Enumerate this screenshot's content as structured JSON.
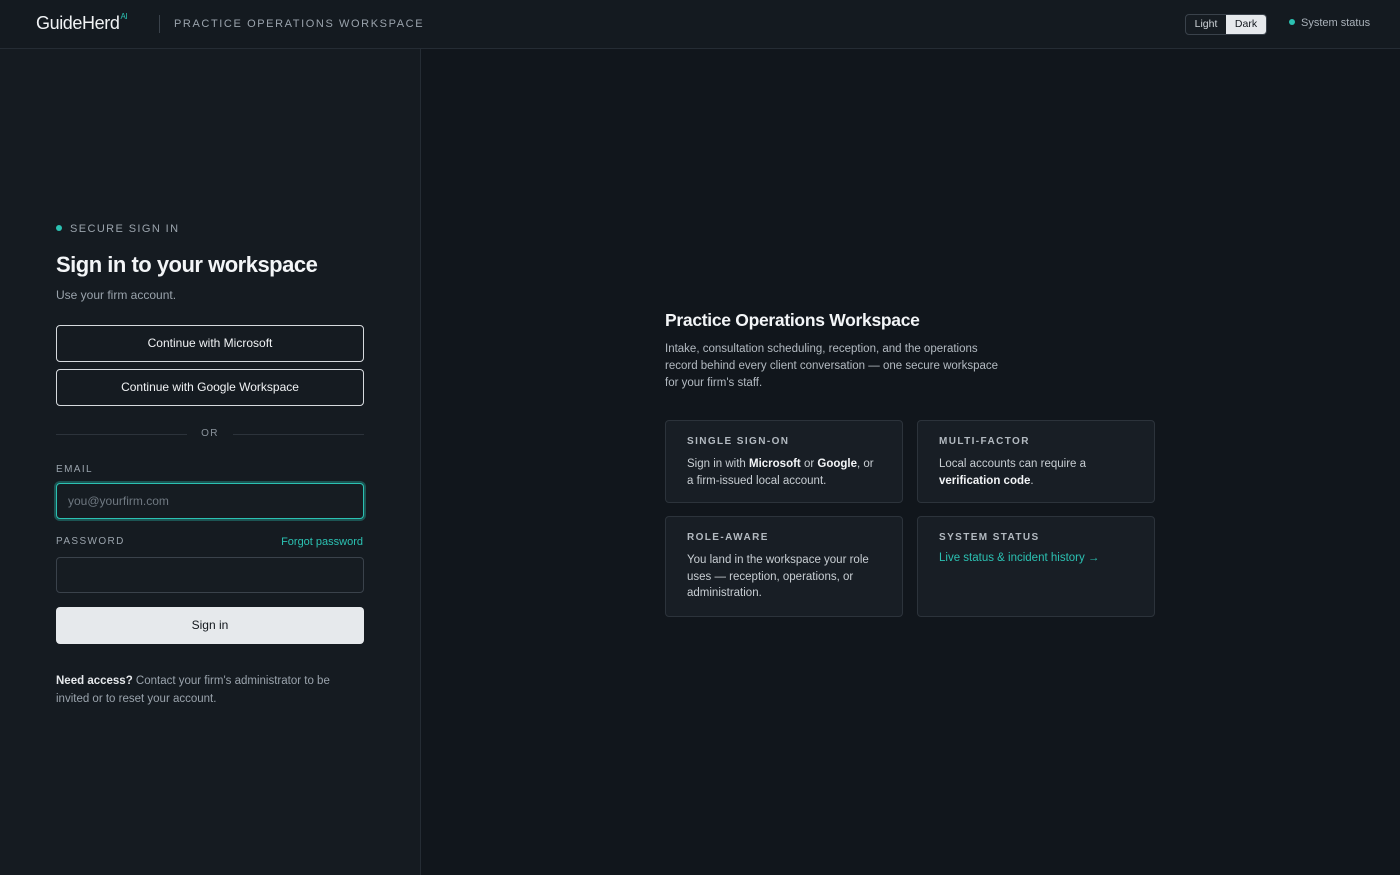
{
  "header": {
    "brand": "GuideHerd",
    "brand_sup": "AI",
    "subtitle": "PRACTICE OPERATIONS WORKSPACE",
    "theme_light": "Light",
    "theme_dark": "Dark",
    "theme_selected": "Dark",
    "system_status": "System status"
  },
  "login": {
    "eyebrow": "SECURE SIGN IN",
    "title": "Sign in to your workspace",
    "subtitle": "Use your firm account.",
    "microsoft_button": "Continue with Microsoft",
    "google_button": "Continue with Google Workspace",
    "divider": "OR",
    "email_label": "EMAIL",
    "email_placeholder": "you@yourfirm.com",
    "email_value": "",
    "password_label": "PASSWORD",
    "forgot_password": "Forgot password",
    "password_value": "",
    "signin_button": "Sign in",
    "need_access_bold": "Need access?",
    "need_access_text": " Contact your firm's administrator to be invited or to reset your account."
  },
  "info": {
    "title": "Practice Operations Workspace",
    "description": "Intake, consultation scheduling, reception, and the operations record behind every client conversation — one secure workspace for your firm's staff.",
    "cards": {
      "sso": {
        "title": "SINGLE SIGN-ON",
        "text_1": "Sign in with ",
        "bold_1": "Microsoft",
        "text_2": " or ",
        "bold_2": "Google",
        "text_3": ", or a firm-issued local account."
      },
      "mfa": {
        "title": "MULTI-FACTOR",
        "text_1": "Local accounts can require a ",
        "bold_1": "verification code",
        "text_2": "."
      },
      "role": {
        "title": "ROLE-AWARE",
        "text": "You land in the workspace your role uses — reception, operations, or administration."
      },
      "status": {
        "title": "SYSTEM STATUS",
        "link": "Live status & incident history →"
      }
    }
  },
  "colors": {
    "accent": "#2bc1b2",
    "background": "#11161c",
    "panel": "#151b21"
  }
}
